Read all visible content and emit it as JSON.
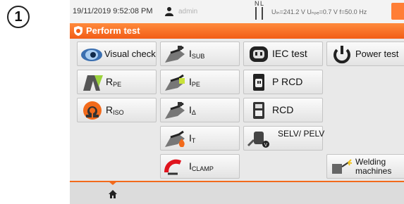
{
  "step_number": "1",
  "status": {
    "datetime": "19/11/2019 9:52:08 PM",
    "user": "admin",
    "phase_n": "N",
    "phase_l": "L",
    "readout": "Uₗₙ=241.2 V Uₙₚₑ=0.7 V f=50.0 Hz"
  },
  "title": "Perform test",
  "tiles": {
    "visual_check": "Visual check",
    "isub": "I",
    "isub_sub": "SUB",
    "iec_test": "IEC test",
    "power_test": "Power test",
    "rpe": "R",
    "rpe_sub": "PE",
    "ipe": "I",
    "ipe_sub": "PE",
    "p_rcd": "P RCD",
    "riso": "R",
    "riso_sub": "ISO",
    "idelta": "I",
    "idelta_sub": "Δ",
    "rcd": "RCD",
    "it": "I",
    "it_sub": "T",
    "selv_pelv": "SELV/ PELV",
    "iclamp": "I",
    "iclamp_sub": "CLAMP",
    "welding": "Welding machines"
  },
  "colors": {
    "accent": "#f26a1b",
    "battery": "#ff7e36",
    "title_text": "#ffffff"
  },
  "icons": {
    "home": "home-icon",
    "user": "user-icon",
    "eye": "eye-icon"
  }
}
